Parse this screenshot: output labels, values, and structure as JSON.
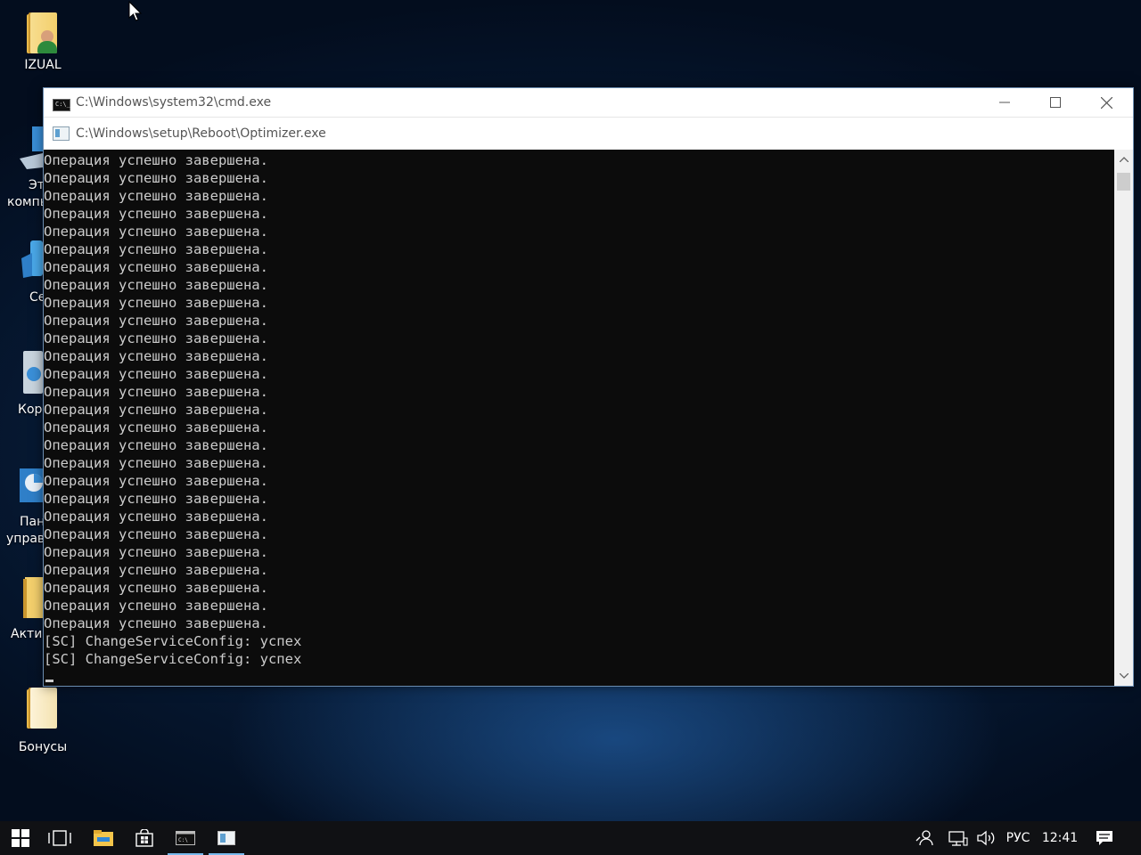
{
  "desktop": {
    "icons": [
      {
        "label": "IZUAL"
      },
      {
        "label": "Эт"
      },
      {
        "label": "компь"
      },
      {
        "label": "Се"
      },
      {
        "label": "Кор"
      },
      {
        "label": "Пан"
      },
      {
        "label": "управ"
      },
      {
        "label": "Акти"
      },
      {
        "label": "Бонусы"
      }
    ]
  },
  "window": {
    "title": "C:\\Windows\\system32\\cmd.exe",
    "tab_title": "C:\\Windows\\setup\\Reboot\\Optimizer.exe",
    "console_lines": [
      "Операция успешно завершена.",
      "Операция успешно завершена.",
      "Операция успешно завершена.",
      "Операция успешно завершена.",
      "Операция успешно завершена.",
      "Операция успешно завершена.",
      "Операция успешно завершена.",
      "Операция успешно завершена.",
      "Операция успешно завершена.",
      "Операция успешно завершена.",
      "Операция успешно завершена.",
      "Операция успешно завершена.",
      "Операция успешно завершена.",
      "Операция успешно завершена.",
      "Операция успешно завершена.",
      "Операция успешно завершена.",
      "Операция успешно завершена.",
      "Операция успешно завершена.",
      "Операция успешно завершена.",
      "Операция успешно завершена.",
      "Операция успешно завершена.",
      "Операция успешно завершена.",
      "Операция успешно завершена.",
      "Операция успешно завершена.",
      "Операция успешно завершена.",
      "Операция успешно завершена.",
      "Операция успешно завершена.",
      "[SC] ChangeServiceConfig: успех",
      "[SC] ChangeServiceConfig: успех"
    ]
  },
  "taskbar": {
    "language": "РУС",
    "time": "12:41"
  },
  "colors": {
    "console_bg": "#0c0c0c",
    "console_text": "#cccccc",
    "taskbar_bg": "#101114",
    "taskbar_active": "#76b9ed"
  }
}
